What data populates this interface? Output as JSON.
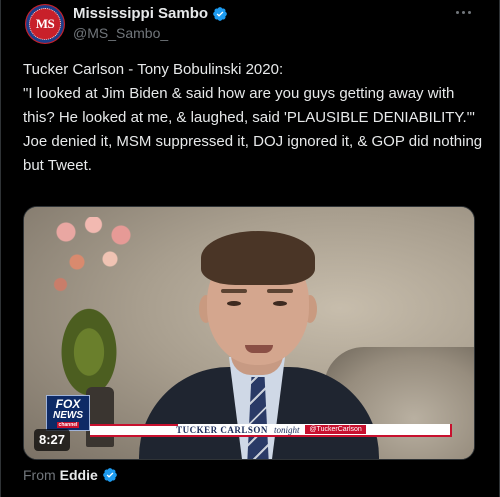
{
  "post": {
    "avatar_text": "MS",
    "display_name": "Mississippi Sambo",
    "handle": "@MS_Sambo_",
    "verified_icon": "verified-badge-icon",
    "more_icon": "more-options-icon",
    "text_lines": [
      "Tucker Carlson - Tony Bobulinski 2020:",
      "\"I looked at Jim Biden & said how are you guys getting away with this? He looked at me, & laughed, said 'PLAUSIBLE DENIABILITY.'\"",
      "Joe denied it, MSM suppressed it, DOJ ignored it, & GOP did nothing but Tweet."
    ]
  },
  "video": {
    "duration": "8:27",
    "logo_line1": "FOX",
    "logo_line2": "NEWS",
    "logo_line3": "channel",
    "lower_third_name": "TUCKER CARLSON",
    "lower_third_show": "tonight",
    "lower_third_handle": "@TuckerCarlson"
  },
  "attribution": {
    "label": "From",
    "name": "Eddie"
  },
  "colors": {
    "background": "#000000",
    "text": "#e7e9ea",
    "secondary": "#71767b",
    "verified": "#1d9bf0",
    "fox_red": "#c8102e"
  }
}
